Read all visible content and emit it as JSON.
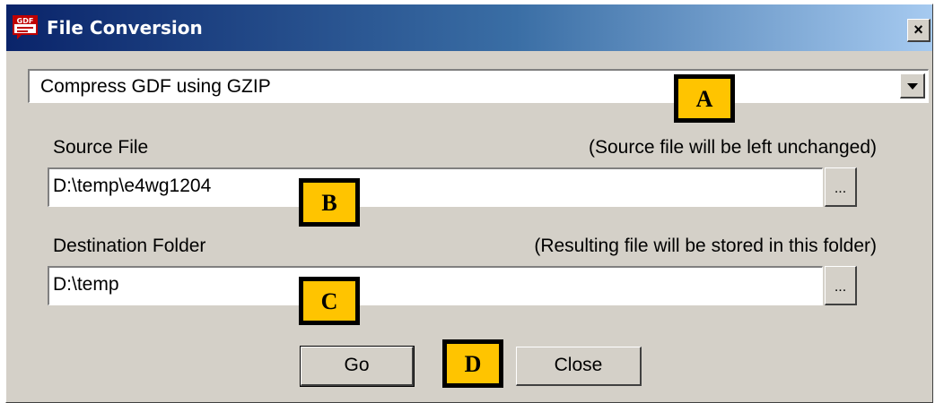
{
  "window": {
    "title": "File Conversion",
    "app_icon": "gdf-app-icon",
    "app_icon_text": "GDF",
    "close_label": "×"
  },
  "conversion": {
    "selected_option": "Compress GDF using GZIP"
  },
  "source": {
    "label": "Source File",
    "hint": "(Source file will be left unchanged)",
    "value": "D:\\temp\\e4wg1204",
    "browse_label": "..."
  },
  "destination": {
    "label": "Destination Folder",
    "hint": "(Resulting file will be stored in this folder)",
    "value": "D:\\temp",
    "browse_label": "..."
  },
  "buttons": {
    "go_label": "Go",
    "close_label": "Close"
  },
  "markers": {
    "a": "A",
    "b": "B",
    "c": "C",
    "d": "D"
  },
  "colors": {
    "marker_fill": "#ffc400",
    "title_gradient_start": "#0a246a",
    "title_gradient_end": "#a6caf0",
    "dialog_face": "#d4d0c8"
  }
}
